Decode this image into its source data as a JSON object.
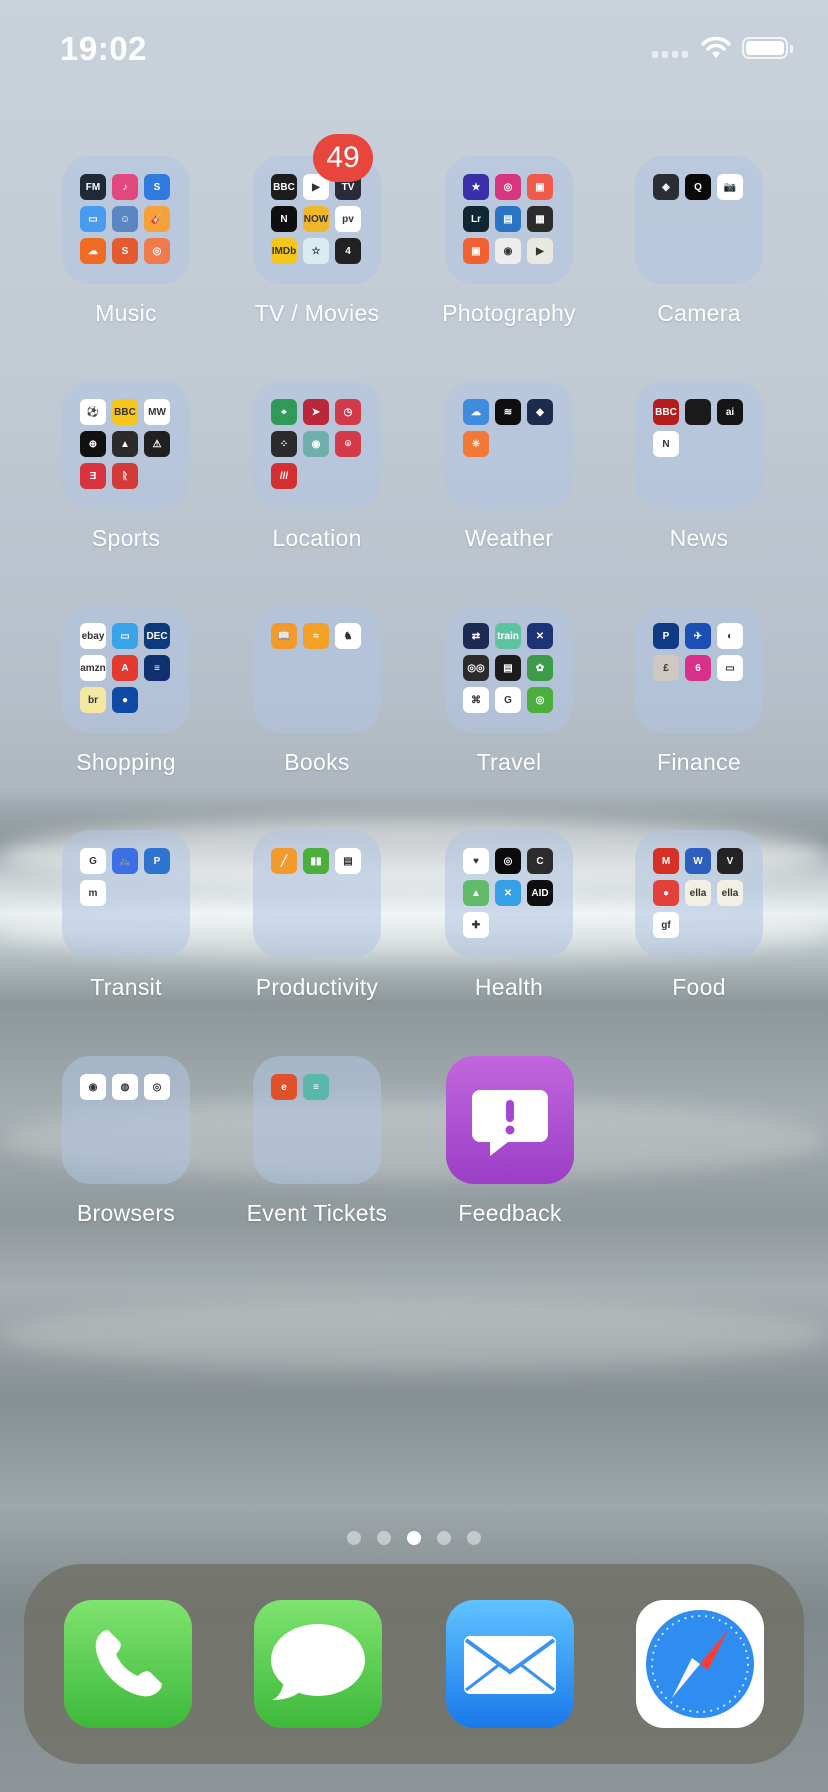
{
  "status_bar": {
    "time": "19:02"
  },
  "pages": {
    "count": 5,
    "active_index": 2
  },
  "folders": [
    {
      "label": "Music",
      "badge": "",
      "minis": [
        {
          "color": "#1f2a36",
          "text": "FM"
        },
        {
          "color": "#e2487d",
          "text": "♪"
        },
        {
          "color": "#2f7be0",
          "text": "S"
        },
        {
          "color": "#4a9cf0",
          "text": "▭"
        },
        {
          "color": "#5a86c4",
          "text": "☺"
        },
        {
          "color": "#f8a13b",
          "text": "🎸"
        },
        {
          "color": "#f06b22",
          "text": "☁"
        },
        {
          "color": "#e55a2f",
          "text": "S"
        },
        {
          "color": "#ef7b4a",
          "text": "◎"
        }
      ]
    },
    {
      "label": "TV / Movies",
      "badge": "49",
      "minis": [
        {
          "color": "#1d1d1d",
          "text": "BBC"
        },
        {
          "color": "#ffffff",
          "text": "▶"
        },
        {
          "color": "#2a2a3a",
          "text": "TV"
        },
        {
          "color": "#0f0f0f",
          "text": "N"
        },
        {
          "color": "#f0b72a",
          "text": "NOW"
        },
        {
          "color": "#ffffff",
          "text": "pv"
        },
        {
          "color": "#f5c518",
          "text": "IMDb"
        },
        {
          "color": "#d8ecf2",
          "text": "☆"
        },
        {
          "color": "#222222",
          "text": "4"
        }
      ]
    },
    {
      "label": "Photography",
      "badge": "",
      "minis": [
        {
          "color": "#3a2fa8",
          "text": "★"
        },
        {
          "color": "#d8357f",
          "text": "◎"
        },
        {
          "color": "#f05a4a",
          "text": "▣"
        },
        {
          "color": "#0e2733",
          "text": "Lr"
        },
        {
          "color": "#2b74c4",
          "text": "▤"
        },
        {
          "color": "#2c2c2c",
          "text": "▦"
        },
        {
          "color": "#f06030",
          "text": "▣"
        },
        {
          "color": "#ededed",
          "text": "◉"
        },
        {
          "color": "#e9e9e2",
          "text": "▶"
        }
      ]
    },
    {
      "label": "Camera",
      "badge": "",
      "minis": [
        {
          "color": "#2a2d34",
          "text": "◈"
        },
        {
          "color": "#0a0a0a",
          "text": "Q"
        },
        {
          "color": "#ffffff",
          "text": "📷"
        }
      ]
    },
    {
      "label": "Sports",
      "badge": "",
      "minis": [
        {
          "color": "#ffffff",
          "text": "⚽"
        },
        {
          "color": "#f5c518",
          "text": "BBC"
        },
        {
          "color": "#ffffff",
          "text": "MW"
        },
        {
          "color": "#111111",
          "text": "⊕"
        },
        {
          "color": "#2b2b2b",
          "text": "▲"
        },
        {
          "color": "#202020",
          "text": "⚠"
        },
        {
          "color": "#d9333f",
          "text": "Ǝ"
        },
        {
          "color": "#d33b3b",
          "text": "ᚱ"
        }
      ]
    },
    {
      "label": "Location",
      "badge": "",
      "minis": [
        {
          "color": "#2f9a5a",
          "text": "⌖"
        },
        {
          "color": "#b8273c",
          "text": "➤"
        },
        {
          "color": "#d23a49",
          "text": "◷"
        },
        {
          "color": "#2b2b2b",
          "text": "⁘"
        },
        {
          "color": "#6fb0ac",
          "text": "◉"
        },
        {
          "color": "#d33b48",
          "text": "⌾"
        },
        {
          "color": "#d42f32",
          "text": "///"
        }
      ]
    },
    {
      "label": "Weather",
      "badge": "",
      "minis": [
        {
          "color": "#3f8cde",
          "text": "☁"
        },
        {
          "color": "#0e0e0e",
          "text": "≋"
        },
        {
          "color": "#1b2c4e",
          "text": "◆"
        },
        {
          "color": "#f07838",
          "text": "☀"
        }
      ]
    },
    {
      "label": "News",
      "badge": "",
      "minis": [
        {
          "color": "#b51d1d",
          "text": "BBC"
        },
        {
          "color": "#1a1a1a",
          "text": ""
        },
        {
          "color": "#151515",
          "text": "ai"
        },
        {
          "color": "#ffffff",
          "text": "N"
        }
      ]
    },
    {
      "label": "Shopping",
      "badge": "",
      "minis": [
        {
          "color": "#ffffff",
          "text": "ebay"
        },
        {
          "color": "#3aa4e8",
          "text": "▭"
        },
        {
          "color": "#0c3a7a",
          "text": "DEC"
        },
        {
          "color": "#ffffff",
          "text": "amzn"
        },
        {
          "color": "#e33a30",
          "text": "A"
        },
        {
          "color": "#0f2f6f",
          "text": "≡"
        },
        {
          "color": "#f3e7a1",
          "text": "br"
        },
        {
          "color": "#0f4aa5",
          "text": "●"
        }
      ]
    },
    {
      "label": "Books",
      "badge": "",
      "minis": [
        {
          "color": "#f39a2c",
          "text": "📖"
        },
        {
          "color": "#f3a126",
          "text": "≈"
        },
        {
          "color": "#ffffff",
          "text": "♞"
        }
      ]
    },
    {
      "label": "Travel",
      "badge": "",
      "minis": [
        {
          "color": "#1b2b55",
          "text": "⇄"
        },
        {
          "color": "#5ec3a2",
          "text": "train"
        },
        {
          "color": "#1c3477",
          "text": "✕"
        },
        {
          "color": "#2b2b2b",
          "text": "◎◎"
        },
        {
          "color": "#1b1b1b",
          "text": "▤"
        },
        {
          "color": "#3e9b4a",
          "text": "✿"
        },
        {
          "color": "#ffffff",
          "text": "⌘"
        },
        {
          "color": "#ffffff",
          "text": "G"
        },
        {
          "color": "#4cae3b",
          "text": "◎"
        }
      ]
    },
    {
      "label": "Finance",
      "badge": "",
      "minis": [
        {
          "color": "#113a85",
          "text": "P"
        },
        {
          "color": "#1b4fb4",
          "text": "✈"
        },
        {
          "color": "#ffffff",
          "text": "◐"
        },
        {
          "color": "#cfc8c0",
          "text": "£"
        },
        {
          "color": "#d82f8a",
          "text": "6"
        },
        {
          "color": "#ffffff",
          "text": "▭"
        }
      ]
    },
    {
      "label": "Transit",
      "badge": "",
      "minis": [
        {
          "color": "#ffffff",
          "text": "G"
        },
        {
          "color": "#3b6fe3",
          "text": "🚲"
        },
        {
          "color": "#2e75cf",
          "text": "P"
        },
        {
          "color": "#ffffff",
          "text": "m"
        }
      ]
    },
    {
      "label": "Productivity",
      "badge": "",
      "minis": [
        {
          "color": "#f39a2c",
          "text": "╱"
        },
        {
          "color": "#4cae3b",
          "text": "▮▮"
        },
        {
          "color": "#ffffff",
          "text": "▤"
        }
      ]
    },
    {
      "label": "Health",
      "badge": "",
      "minis": [
        {
          "color": "#ffffff",
          "text": "♥"
        },
        {
          "color": "#0b0b0b",
          "text": "◎"
        },
        {
          "color": "#2c2c2c",
          "text": "C"
        },
        {
          "color": "#61b96a",
          "text": "▲"
        },
        {
          "color": "#35a0e5",
          "text": "✕"
        },
        {
          "color": "#0f0f0f",
          "text": "AID"
        },
        {
          "color": "#ffffff",
          "text": "✚"
        }
      ]
    },
    {
      "label": "Food",
      "badge": "",
      "minis": [
        {
          "color": "#d62f24",
          "text": "M"
        },
        {
          "color": "#2c5fbe",
          "text": "W"
        },
        {
          "color": "#232323",
          "text": "V"
        },
        {
          "color": "#e4403a",
          "text": "●"
        },
        {
          "color": "#f4efe4",
          "text": "ella"
        },
        {
          "color": "#f4efe4",
          "text": "ella"
        },
        {
          "color": "#ffffff",
          "text": "gf"
        }
      ]
    },
    {
      "label": "Browsers",
      "badge": "",
      "minis": [
        {
          "color": "#ffffff",
          "text": "◉"
        },
        {
          "color": "#ffffff",
          "text": "◍"
        },
        {
          "color": "#ffffff",
          "text": "◎"
        }
      ]
    },
    {
      "label": "Event Tickets",
      "badge": "",
      "minis": [
        {
          "color": "#e0512a",
          "text": "e"
        },
        {
          "color": "#5ab7ac",
          "text": "≡"
        }
      ]
    }
  ],
  "apps": [
    {
      "label": "Feedback"
    }
  ],
  "dock": [
    {
      "name": "Phone"
    },
    {
      "name": "Messages"
    },
    {
      "name": "Mail"
    },
    {
      "name": "Safari"
    }
  ]
}
